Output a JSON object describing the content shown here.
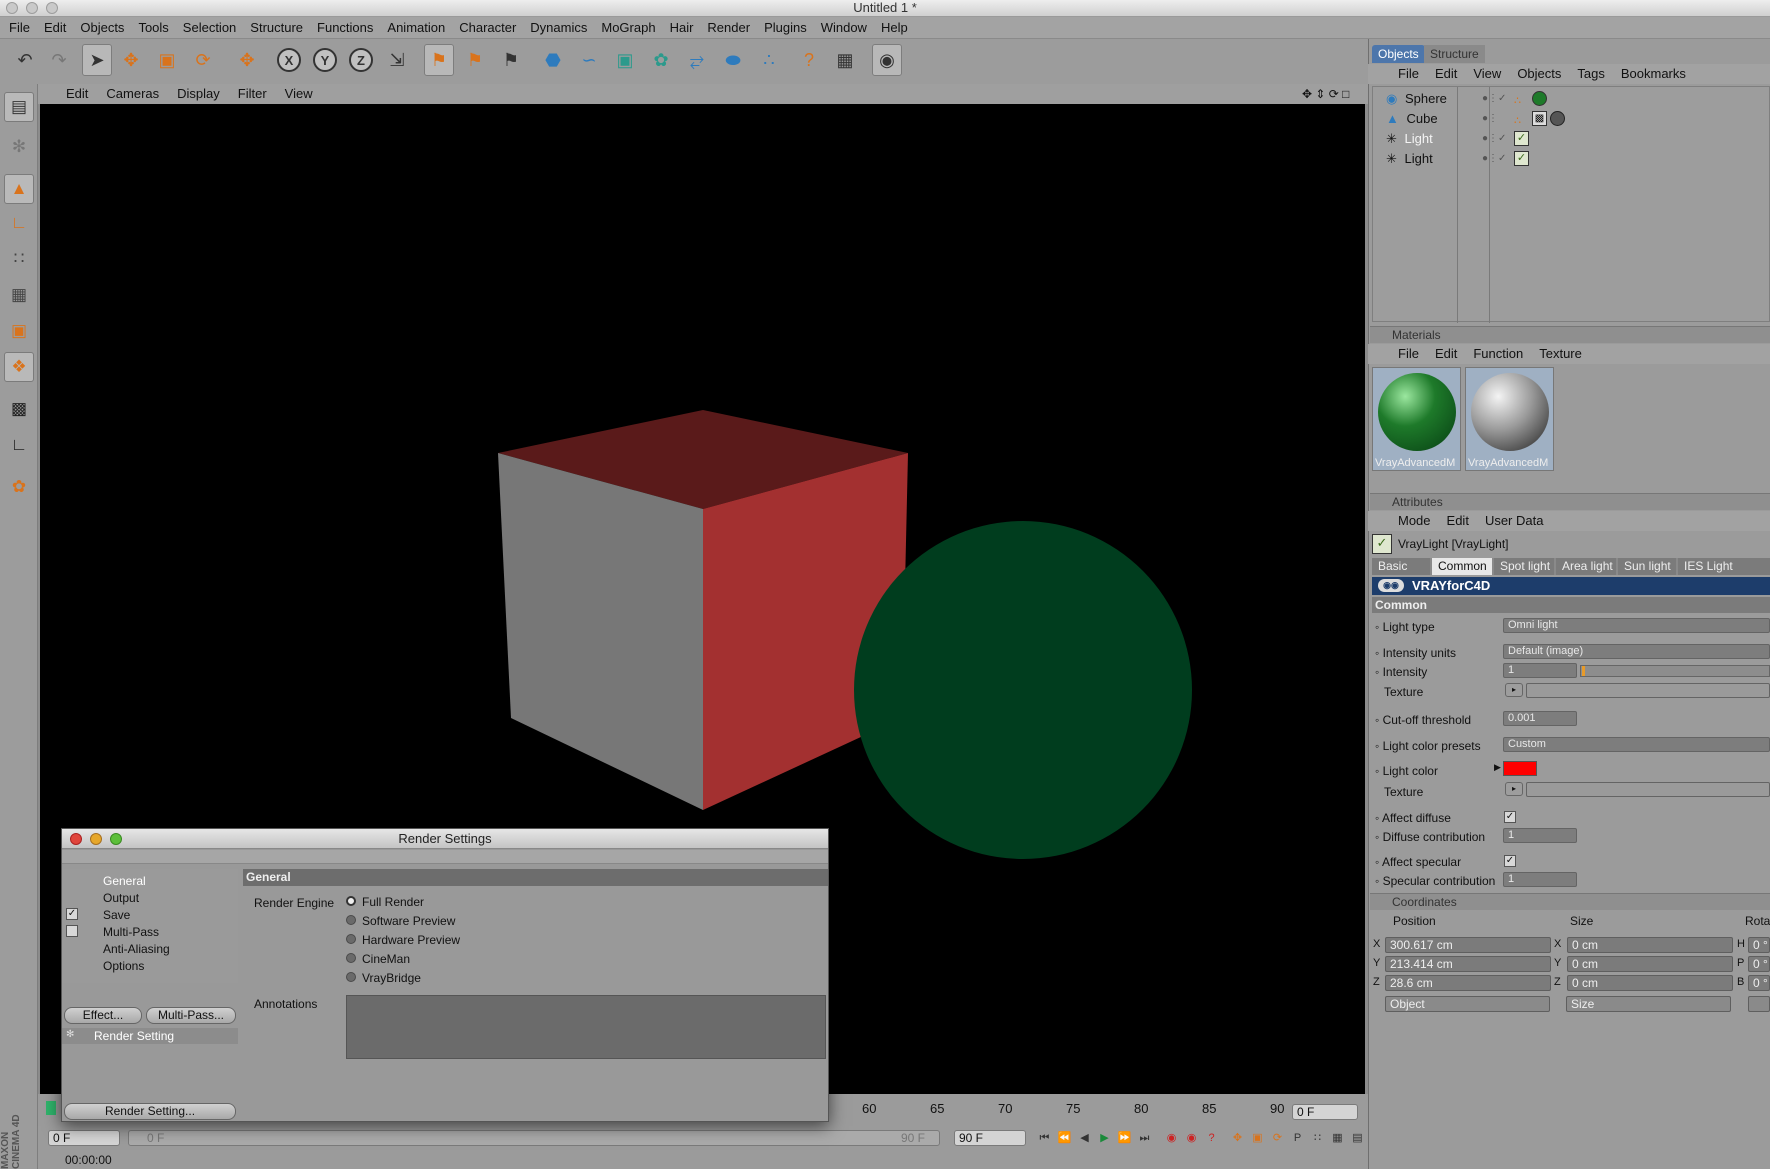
{
  "window": {
    "title": "Untitled 1 *"
  },
  "menubar": [
    "File",
    "Edit",
    "Objects",
    "Tools",
    "Selection",
    "Structure",
    "Functions",
    "Animation",
    "Character",
    "Dynamics",
    "MoGraph",
    "Hair",
    "Render",
    "Plugins",
    "Window",
    "Help"
  ],
  "viewport_menu": [
    "Edit",
    "Cameras",
    "Display",
    "Filter",
    "View"
  ],
  "objects_panel": {
    "tabs": [
      "Objects",
      "Structure"
    ],
    "menu": [
      "File",
      "Edit",
      "View",
      "Objects",
      "Tags",
      "Bookmarks"
    ],
    "items": [
      {
        "name": "Sphere",
        "type": "sphere"
      },
      {
        "name": "Cube",
        "type": "cube"
      },
      {
        "name": "Light",
        "type": "light"
      },
      {
        "name": "Light",
        "type": "light"
      }
    ]
  },
  "materials_panel": {
    "title": "Materials",
    "menu": [
      "File",
      "Edit",
      "Function",
      "Texture"
    ],
    "materials": [
      {
        "name": "VrayAdvancedM",
        "color": "#1e7a2a"
      },
      {
        "name": "VrayAdvancedM",
        "color": "#9a9a9a"
      }
    ]
  },
  "attributes_panel": {
    "title": "Attributes",
    "menu": [
      "Mode",
      "Edit",
      "User Data"
    ],
    "object_title": "VrayLight [VrayLight]",
    "tabs": [
      "Basic",
      "Common",
      "Spot light",
      "Area light",
      "Sun light",
      "IES Light"
    ],
    "active_tab": "Common",
    "brand": "VRAYforC4D",
    "section": "Common",
    "fields": {
      "light_type_label": "Light type",
      "light_type_value": "Omni light",
      "intensity_units_label": "Intensity units",
      "intensity_units_value": "Default (image)",
      "intensity_label": "Intensity",
      "intensity_value": "1",
      "texture_label": "Texture",
      "cutoff_label": "Cut-off threshold",
      "cutoff_value": "0.001",
      "color_presets_label": "Light color presets",
      "color_presets_value": "Custom",
      "light_color_label": "Light color",
      "light_color": "#ff0000",
      "texture2_label": "Texture",
      "affect_diffuse_label": "Affect diffuse",
      "diffuse_contrib_label": "Diffuse contribution",
      "diffuse_contrib_value": "1",
      "affect_specular_label": "Affect specular",
      "specular_contrib_label": "Specular contribution",
      "specular_contrib_value": "1"
    }
  },
  "coordinates_panel": {
    "title": "Coordinates",
    "headers": {
      "position": "Position",
      "size": "Size",
      "rotation": "Rota"
    },
    "axes": [
      "X",
      "Y",
      "Z"
    ],
    "position": [
      "300.617 cm",
      "213.414 cm",
      "28.6 cm"
    ],
    "size": [
      "0 cm",
      "0 cm",
      "0 cm"
    ],
    "rot_axes": [
      "H",
      "P",
      "B"
    ],
    "rotation": [
      "0 °",
      "0 °",
      "0 °"
    ],
    "mode_select": "Object",
    "size_select": "Size"
  },
  "render_dialog": {
    "title": "Render Settings",
    "nav": [
      "General",
      "Output",
      "Save",
      "Multi-Pass",
      "Anti-Aliasing",
      "Options"
    ],
    "section": "General",
    "render_engine_label": "Render Engine",
    "engines": [
      "Full Render",
      "Software Preview",
      "Hardware Preview",
      "CineMan",
      "VrayBridge"
    ],
    "selected_engine": "Full Render",
    "annotations_label": "Annotations",
    "effect_button": "Effect...",
    "multipass_button": "Multi-Pass...",
    "preset_item": "Render Setting",
    "render_setting_button": "Render Setting..."
  },
  "timeline": {
    "ticks": [
      "60",
      "65",
      "70",
      "75",
      "80",
      "85",
      "90"
    ],
    "current_frame_right": "0 F",
    "start_field": "0 F",
    "start_slider": "0 F",
    "end_slider": "90 F",
    "end_field": "90 F",
    "time": "00:00:00"
  },
  "brand_vertical": "MAXON CINEMA 4D",
  "colors": {
    "cube_red": "#a32a2a",
    "sphere_green": "#003d1e",
    "accent_orange": "#d9731c"
  }
}
